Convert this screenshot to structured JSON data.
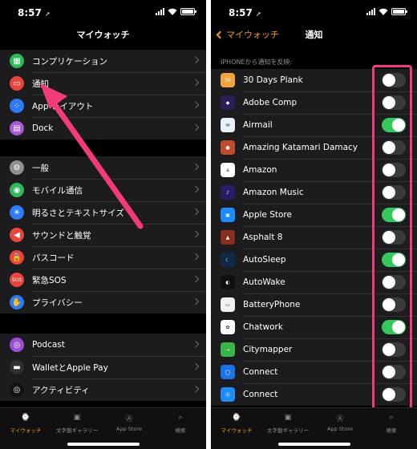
{
  "left": {
    "status": {
      "time": "8:57",
      "location_glyph": "➚"
    },
    "title": "マイウォッチ",
    "groups": [
      [
        {
          "label": "コンプリケーション",
          "icon": "complication-icon",
          "color": "#30b85b",
          "glyph": "▦"
        },
        {
          "label": "通知",
          "icon": "notification-icon",
          "color": "#e8453c",
          "glyph": "▭"
        },
        {
          "label": "App レイアウト",
          "icon": "app-layout-icon",
          "color": "#2d7cf6",
          "glyph": "⁘"
        },
        {
          "label": "Dock",
          "icon": "dock-icon",
          "color": "#a55bd3",
          "glyph": "▤"
        }
      ],
      [
        {
          "label": "一般",
          "icon": "gear-icon",
          "color": "#8e8e93",
          "glyph": "⚙"
        },
        {
          "label": "モバイル通信",
          "icon": "cellular-icon",
          "color": "#30b85b",
          "glyph": "◉"
        },
        {
          "label": "明るさとテキストサイズ",
          "icon": "brightness-icon",
          "color": "#2d7cf6",
          "glyph": "☀"
        },
        {
          "label": "サウンドと触覚",
          "icon": "sound-icon",
          "color": "#e8453c",
          "glyph": "◀"
        },
        {
          "label": "パスコード",
          "icon": "lock-icon",
          "color": "#e8453c",
          "glyph": "🔒"
        },
        {
          "label": "緊急SOS",
          "icon": "sos-icon",
          "color": "#e8453c",
          "glyph": "SOS"
        },
        {
          "label": "プライバシー",
          "icon": "hand-icon",
          "color": "#2d7cf6",
          "glyph": "✋"
        }
      ],
      [
        {
          "label": "Podcast",
          "icon": "podcast-icon",
          "color": "#9b4fd6",
          "glyph": "◎"
        },
        {
          "label": "WalletとApple Pay",
          "icon": "wallet-icon",
          "color": "#2f2f33",
          "glyph": "▬"
        },
        {
          "label": "アクティビティ",
          "icon": "activity-icon",
          "color": "#111111",
          "glyph": "◎"
        }
      ]
    ],
    "tabs": [
      {
        "label": "マイウォッチ",
        "icon": "watch-icon",
        "glyph": "⌚",
        "active": true
      },
      {
        "label": "文字盤ギャラリー",
        "icon": "face-gallery-icon",
        "glyph": "▣",
        "active": false
      },
      {
        "label": "App Store",
        "icon": "app-store-icon",
        "glyph": "Ⓐ",
        "active": false
      },
      {
        "label": "検索",
        "icon": "search-icon",
        "glyph": "⌕",
        "active": false
      }
    ]
  },
  "right": {
    "status": {
      "time": "8:57",
      "location_glyph": "➚"
    },
    "back_label": "マイウォッチ",
    "title": "通知",
    "section_header": "IPHONEから通知を反映:",
    "apps": [
      {
        "name": "30 Days Plank",
        "icon": "plank-app-icon",
        "color": "#f2a33a",
        "glyph": "30",
        "on": false
      },
      {
        "name": "Adobe Comp",
        "icon": "adobe-comp-icon",
        "color": "#2b1e56",
        "glyph": "◆",
        "on": false
      },
      {
        "name": "Airmail",
        "icon": "airmail-icon",
        "color": "#e9f3ff",
        "glyph": "✉",
        "on": true
      },
      {
        "name": "Amazing Katamari Damacy",
        "icon": "katamari-icon",
        "color": "#c24a2c",
        "glyph": "●",
        "on": false
      },
      {
        "name": "Amazon",
        "icon": "amazon-icon",
        "color": "#ffffff",
        "glyph": "a",
        "on": false
      },
      {
        "name": "Amazon Music",
        "icon": "amazon-music-icon",
        "color": "#2a1d66",
        "glyph": "♪",
        "on": false
      },
      {
        "name": "Apple Store",
        "icon": "apple-store-icon",
        "color": "#1a8cff",
        "glyph": "▣",
        "on": true
      },
      {
        "name": "Asphalt 8",
        "icon": "asphalt-icon",
        "color": "#8a2e1e",
        "glyph": "▲",
        "on": false
      },
      {
        "name": "AutoSleep",
        "icon": "autosleep-icon",
        "color": "#0f2a44",
        "glyph": "☾",
        "on": true
      },
      {
        "name": "AutoWake",
        "icon": "autowake-icon",
        "color": "#101010",
        "glyph": "◐",
        "on": false
      },
      {
        "name": "BatteryPhone",
        "icon": "batteryphone-icon",
        "color": "#f2f2f2",
        "glyph": "▭",
        "on": false
      },
      {
        "name": "Chatwork",
        "icon": "chatwork-icon",
        "color": "#ffffff",
        "glyph": "✿",
        "on": true
      },
      {
        "name": "Citymapper",
        "icon": "citymapper-icon",
        "color": "#39b54a",
        "glyph": "→",
        "on": false
      },
      {
        "name": "Connect",
        "icon": "connect-icon",
        "color": "#1a73e8",
        "glyph": "◯",
        "on": false
      },
      {
        "name": "Connect",
        "icon": "app-store-connect-icon",
        "color": "#1e8cff",
        "glyph": "Ⓐ",
        "on": false
      }
    ],
    "tabs": [
      {
        "label": "マイウォッチ",
        "icon": "watch-icon",
        "glyph": "⌚",
        "active": true
      },
      {
        "label": "文字盤ギャラリー",
        "icon": "face-gallery-icon",
        "glyph": "▣",
        "active": false
      },
      {
        "label": "App Store",
        "icon": "app-store-icon",
        "glyph": "Ⓐ",
        "active": false
      },
      {
        "label": "検索",
        "icon": "search-icon",
        "glyph": "⌕",
        "active": false
      }
    ]
  },
  "colors": {
    "accent": "#f39a13",
    "highlight": "#f23b7c",
    "toggle_on": "#34c759"
  }
}
